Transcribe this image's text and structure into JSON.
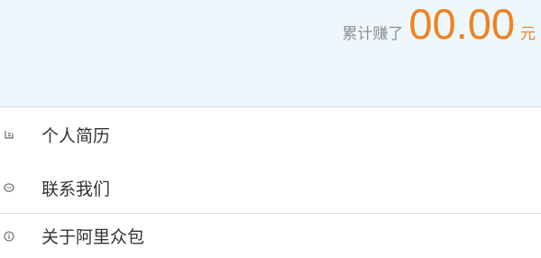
{
  "earnings": {
    "label": "累计赚了",
    "amount": "00.00",
    "unit": "元"
  },
  "menu": {
    "items": [
      {
        "label": "个人简历",
        "icon": "resume-icon"
      },
      {
        "label": "联系我们",
        "icon": "chat-icon"
      },
      {
        "label": "关于阿里众包",
        "icon": "info-icon"
      }
    ]
  },
  "colors": {
    "accent": "#f08222",
    "header_background": "#eef7fc",
    "label_gray": "#8e8e8e",
    "text": "#333333"
  }
}
